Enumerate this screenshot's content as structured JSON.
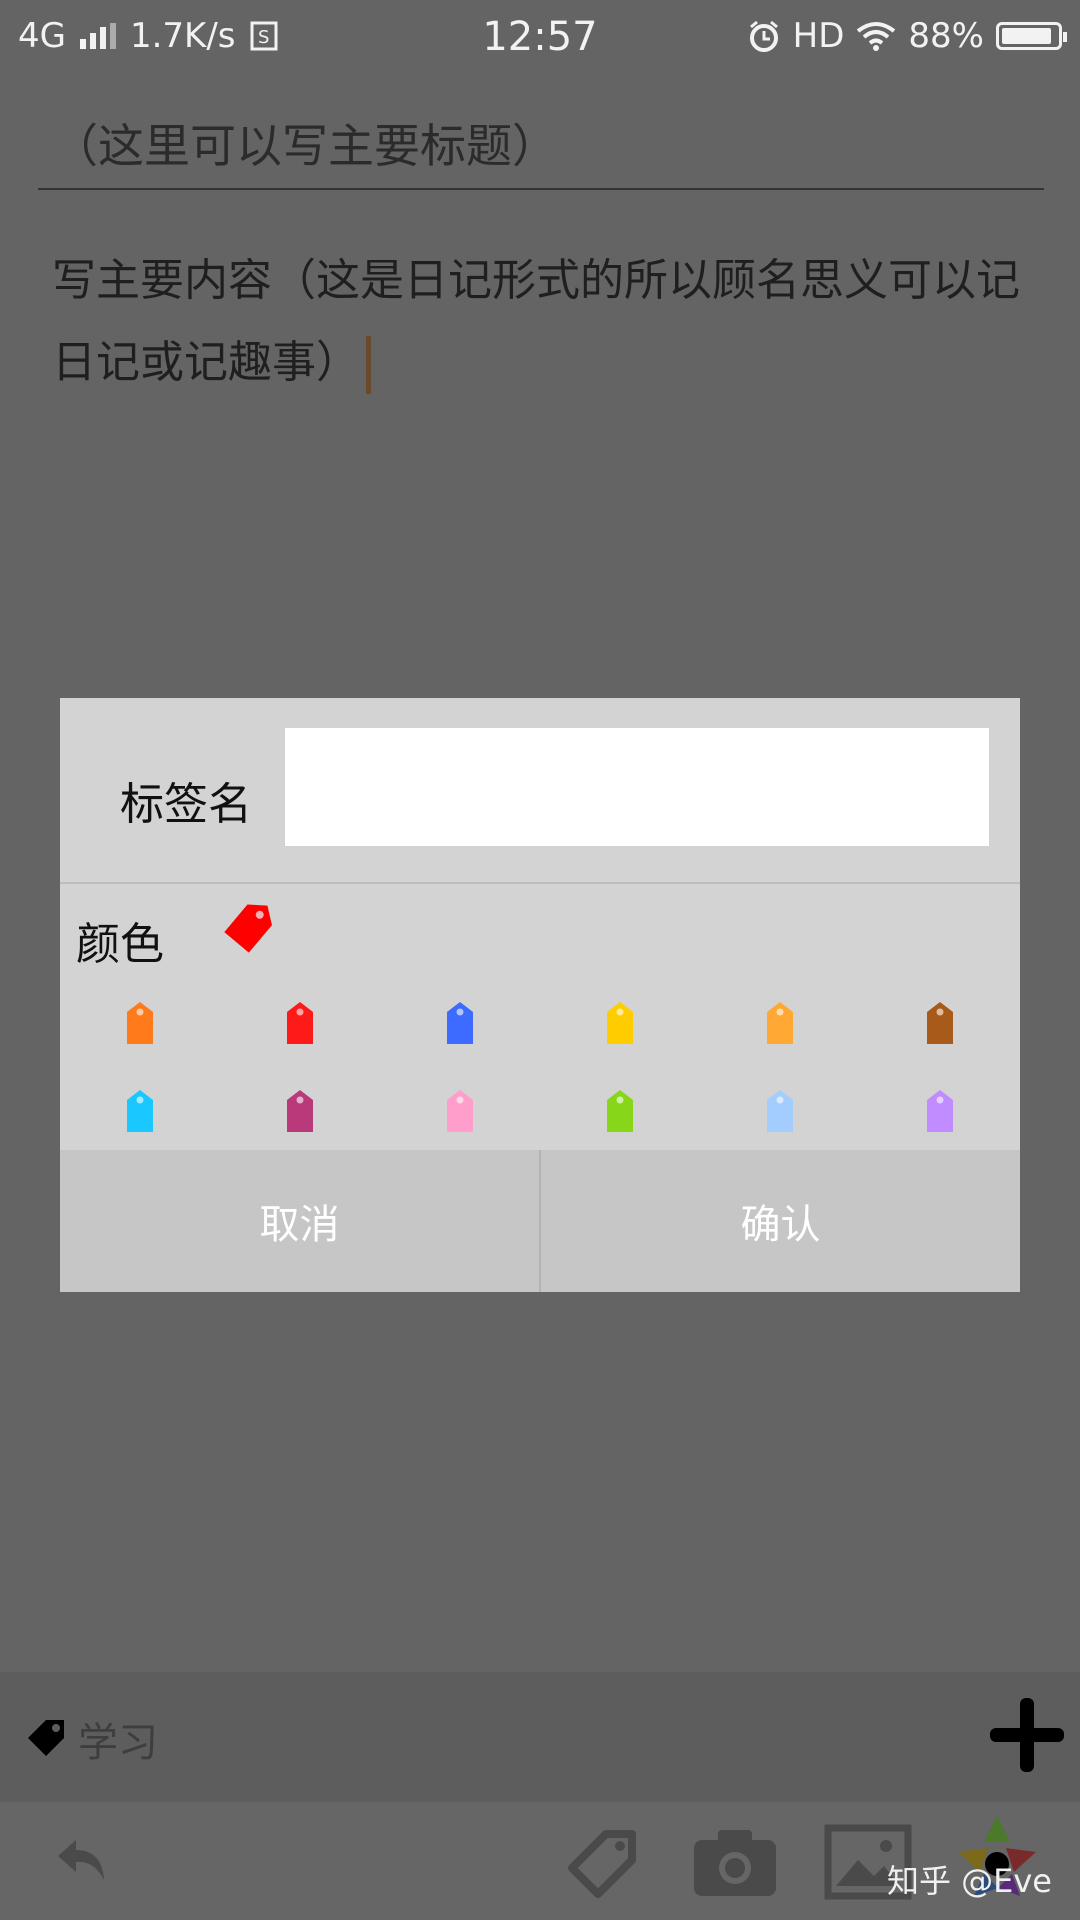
{
  "status_bar": {
    "network": "4G",
    "speed": "1.7K/s",
    "time": "12:57",
    "hd": "HD",
    "battery": "88%"
  },
  "editor": {
    "title": "（这里可以写主要标题）",
    "content": "写主要内容（这是日记形式的所以顾名思义可以记日记或记趣事）"
  },
  "dialog": {
    "name_label": "标签名",
    "name_value": "",
    "color_label": "颜色",
    "selected_color": "#ff0000",
    "colors": [
      "#ff7a1a",
      "#ff1a1a",
      "#3d6bff",
      "#ffcc00",
      "#ffa833",
      "#a85a1a",
      "#1ac8ff",
      "#b83a7a",
      "#ff9ecb",
      "#88d61a",
      "#a3ccff",
      "#c08cff"
    ],
    "cancel_label": "取消",
    "confirm_label": "确认"
  },
  "tag_bar": {
    "current_tag": "学习"
  },
  "watermark": "知乎 @Eve"
}
